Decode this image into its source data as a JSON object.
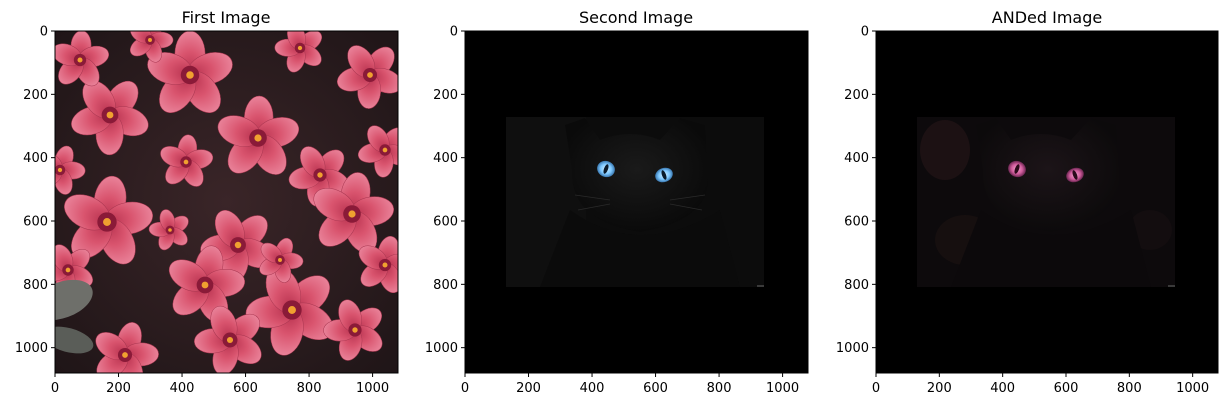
{
  "chart_data": [
    {
      "type": "image",
      "title": "First Image",
      "xlim": [
        0,
        1080
      ],
      "ylim": [
        1080,
        0
      ],
      "xticks": [
        0,
        200,
        400,
        600,
        800,
        1000
      ],
      "yticks": [
        0,
        200,
        400,
        600,
        800,
        1000
      ],
      "image_content": "pink flowers (oxalis) on dark background",
      "colors": {
        "petal": "#d9546e",
        "petal_light": "#e87d92",
        "center": "#8a1a38",
        "background": "#2a1d1f",
        "leaf": "#6e6f6a"
      }
    },
    {
      "type": "image",
      "title": "Second Image",
      "xlim": [
        0,
        1080
      ],
      "ylim": [
        1080,
        0
      ],
      "xticks": [
        0,
        200,
        400,
        600,
        800,
        1000
      ],
      "yticks": [
        0,
        200,
        400,
        600,
        800,
        1000
      ],
      "image_content": "black cat with blue eyes, inset on black canvas",
      "inset": {
        "x": [
          130,
          940
        ],
        "y": [
          270,
          810
        ]
      },
      "colors": {
        "canvas": "#000000",
        "inset_bg": "#0d0d0d",
        "eyes": "#7ec8ff"
      }
    },
    {
      "type": "image",
      "title": "ANDed Image",
      "xlim": [
        0,
        1080
      ],
      "ylim": [
        1080,
        0
      ],
      "xticks": [
        0,
        200,
        400,
        600,
        800,
        1000
      ],
      "yticks": [
        0,
        200,
        400,
        600,
        800,
        1000
      ],
      "image_content": "bitwise AND of the two images: dark cat with faint flower colors, pink eyes",
      "inset": {
        "x": [
          130,
          940
        ],
        "y": [
          270,
          810
        ]
      },
      "colors": {
        "canvas": "#000000",
        "inset_bg": "#0e0b0d",
        "eyes": "#e26aa8"
      }
    }
  ]
}
